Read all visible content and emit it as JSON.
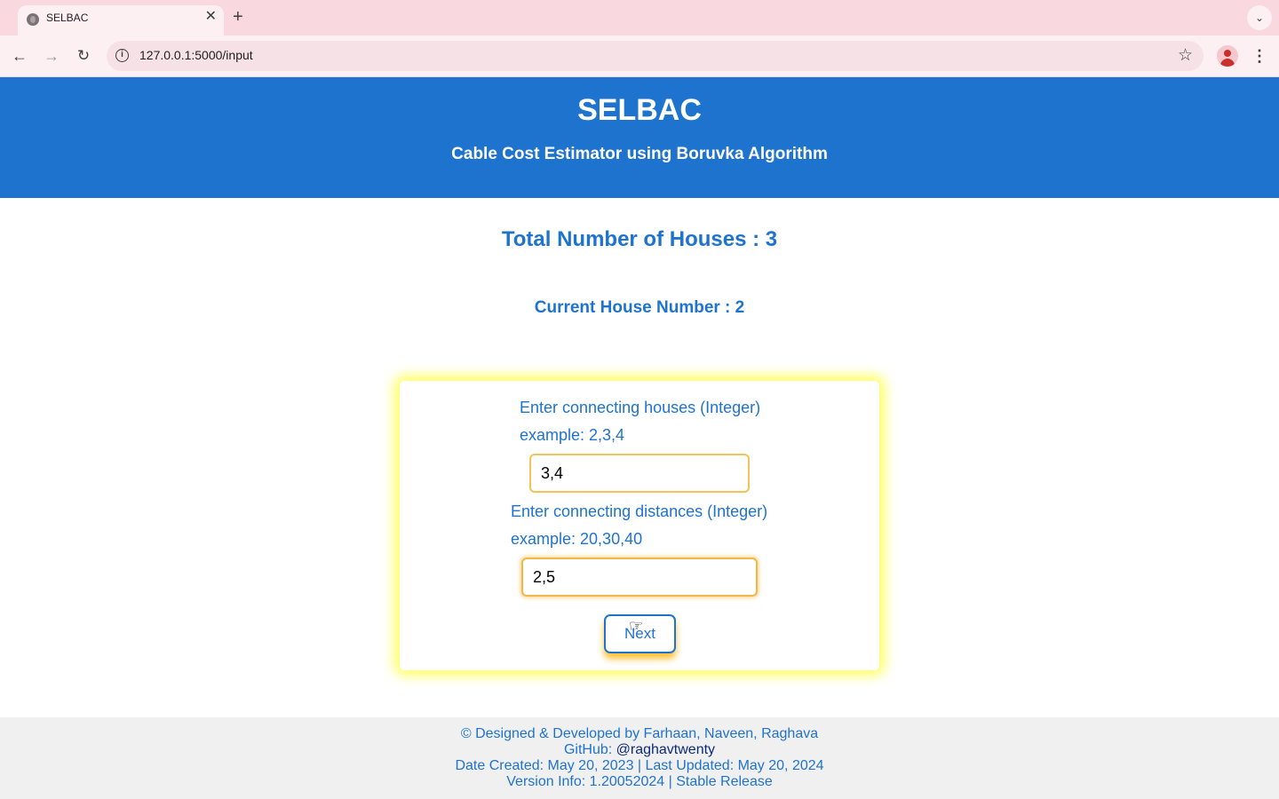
{
  "browser": {
    "tab_title": "SELBAC",
    "tab_close": "✕",
    "new_tab": "+",
    "url": "127.0.0.1:5000/input"
  },
  "header": {
    "title": "SELBAC",
    "subtitle": "Cable Cost Estimator using Boruvka Algorithm"
  },
  "main": {
    "total_houses": "Total Number of Houses : 3",
    "current_house": "Current House Number : 2"
  },
  "form": {
    "houses_label": "Enter connecting houses (Integer)",
    "houses_example": "example: 2,3,4",
    "houses_value": "3,4",
    "distances_label": "Enter connecting distances (Integer)",
    "distances_example": "example: 20,30,40",
    "distances_value": "2,5",
    "next_label": "Next"
  },
  "footer": {
    "credits": "© Designed & Developed by Farhaan, Naveen, Raghava",
    "github_prefix": "GitHub: ",
    "github_handle": "@raghavtwenty",
    "dates": "Date Created: May 20, 2023 | Last Updated: May 20, 2024",
    "version": "Version Info: 1.20052024 | Stable Release"
  },
  "colors": {
    "accent": "#1e73cf",
    "input_border": "#f4c257",
    "card_glow": "#ffff60"
  }
}
